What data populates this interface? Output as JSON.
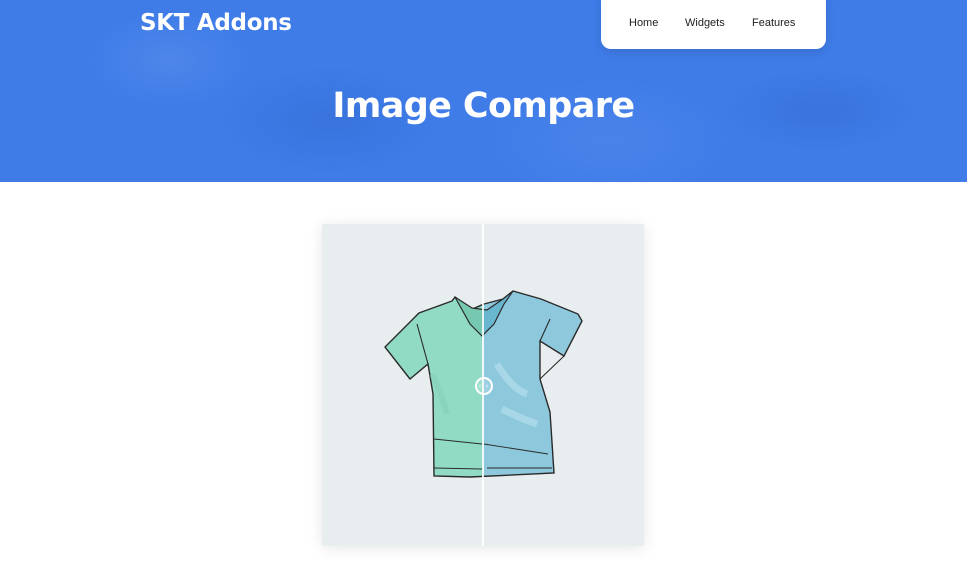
{
  "brand": {
    "logo_text": "SKT Addons"
  },
  "nav": {
    "items": [
      {
        "label": "Home"
      },
      {
        "label": "Widgets"
      },
      {
        "label": "Features"
      }
    ]
  },
  "hero": {
    "title": "Image Compare",
    "background_color": "#3f7ce8"
  },
  "image_compare": {
    "before_image": "t-shirt (green)",
    "after_image": "t-shirt (blue)",
    "slider_position": 0.5,
    "colors": {
      "before": "#8fd7c2",
      "after": "#8cc7dc",
      "background": "#e8edf0"
    },
    "handle_icon": "left-right-arrows-icon"
  }
}
